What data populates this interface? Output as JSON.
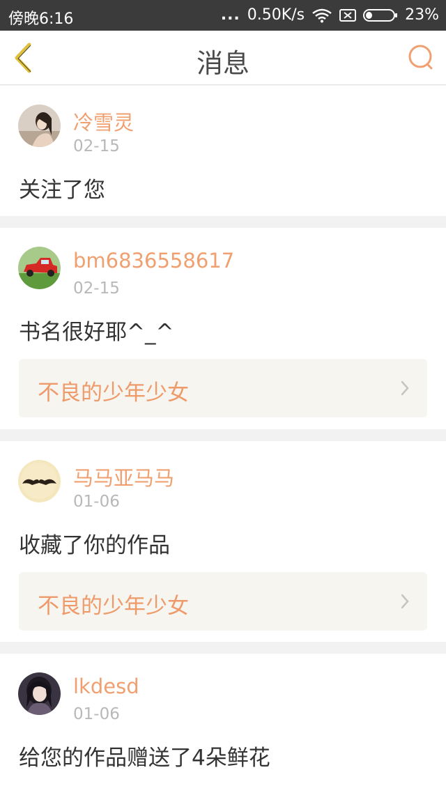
{
  "status_bar": {
    "time": "傍晚6:16",
    "signal_dots": "...",
    "network_speed": "0.50K/s",
    "battery": "23%",
    "battery_level": 0.23,
    "icons": [
      "wifi-icon",
      "sim-icon",
      "battery-icon"
    ]
  },
  "header": {
    "title": "消息",
    "back_icon": "chevron-left-icon",
    "search_icon": "search-icon"
  },
  "colors": {
    "accent": "#f0a070",
    "back_arrow": "#e0c040",
    "link_bg": "#f6f5ef"
  },
  "messages": [
    {
      "username": "冷雪灵",
      "date": "02-15",
      "text": "关注了您",
      "avatar": "girl-photo"
    },
    {
      "username": "bm6836558617",
      "date": "02-15",
      "text": "书名很好耶^_^",
      "avatar": "red-car",
      "work_title": "不良的少年少女"
    },
    {
      "username": "马马亚马马",
      "date": "01-06",
      "text": "收藏了你的作品",
      "avatar": "mustache",
      "work_title": "不良的少年少女"
    },
    {
      "username": "lkdesd",
      "date": "01-06",
      "text": "给您的作品赠送了4朵鲜花",
      "avatar": "girl-photo-dark"
    }
  ]
}
